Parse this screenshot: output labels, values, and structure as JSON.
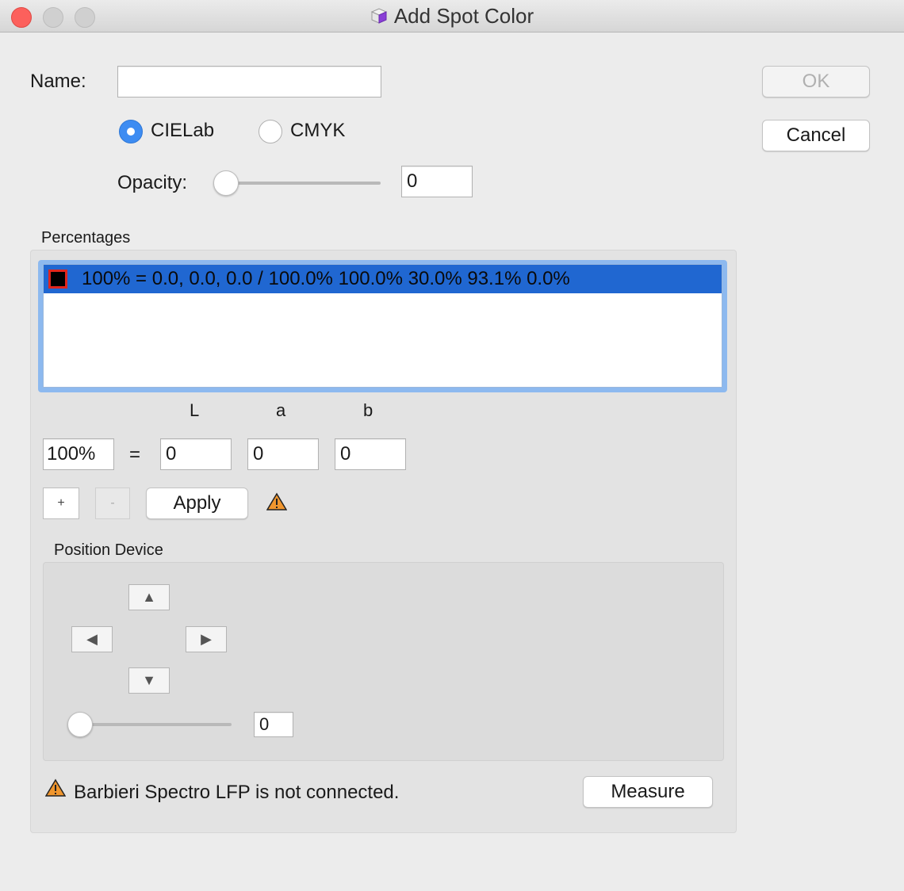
{
  "window": {
    "title": "Add Spot Color"
  },
  "form": {
    "name_label": "Name:",
    "name_value": "",
    "color_modes": [
      {
        "label": "CIELab",
        "selected": true
      },
      {
        "label": "CMYK",
        "selected": false
      }
    ],
    "opacity_label": "Opacity:",
    "opacity_value": "0"
  },
  "buttons": {
    "ok": "OK",
    "cancel": "Cancel",
    "apply": "Apply",
    "measure": "Measure",
    "add": "+",
    "remove": "-"
  },
  "percentages": {
    "section_label": "Percentages",
    "rows": [
      {
        "text": "100% = 0.0, 0.0, 0.0 / 100.0% 100.0% 30.0% 93.1% 0.0%",
        "swatch_color": "#000000",
        "selected": true
      }
    ],
    "column_headers": [
      "L",
      "a",
      "b"
    ],
    "percent_value": "100%",
    "equals": "=",
    "l_value": "0",
    "a_value": "0",
    "b_value": "0"
  },
  "position_device": {
    "section_label": "Position Device",
    "up": "▲",
    "down": "▼",
    "left": "◀",
    "right": "▶",
    "slider_value": "0"
  },
  "status": {
    "message": "Barbieri Spectro LFP is not connected."
  },
  "colors": {
    "accent": "#3d8cf2",
    "selection": "#2067d1",
    "warning": "#f0962e",
    "close_light": "#fc605c"
  }
}
